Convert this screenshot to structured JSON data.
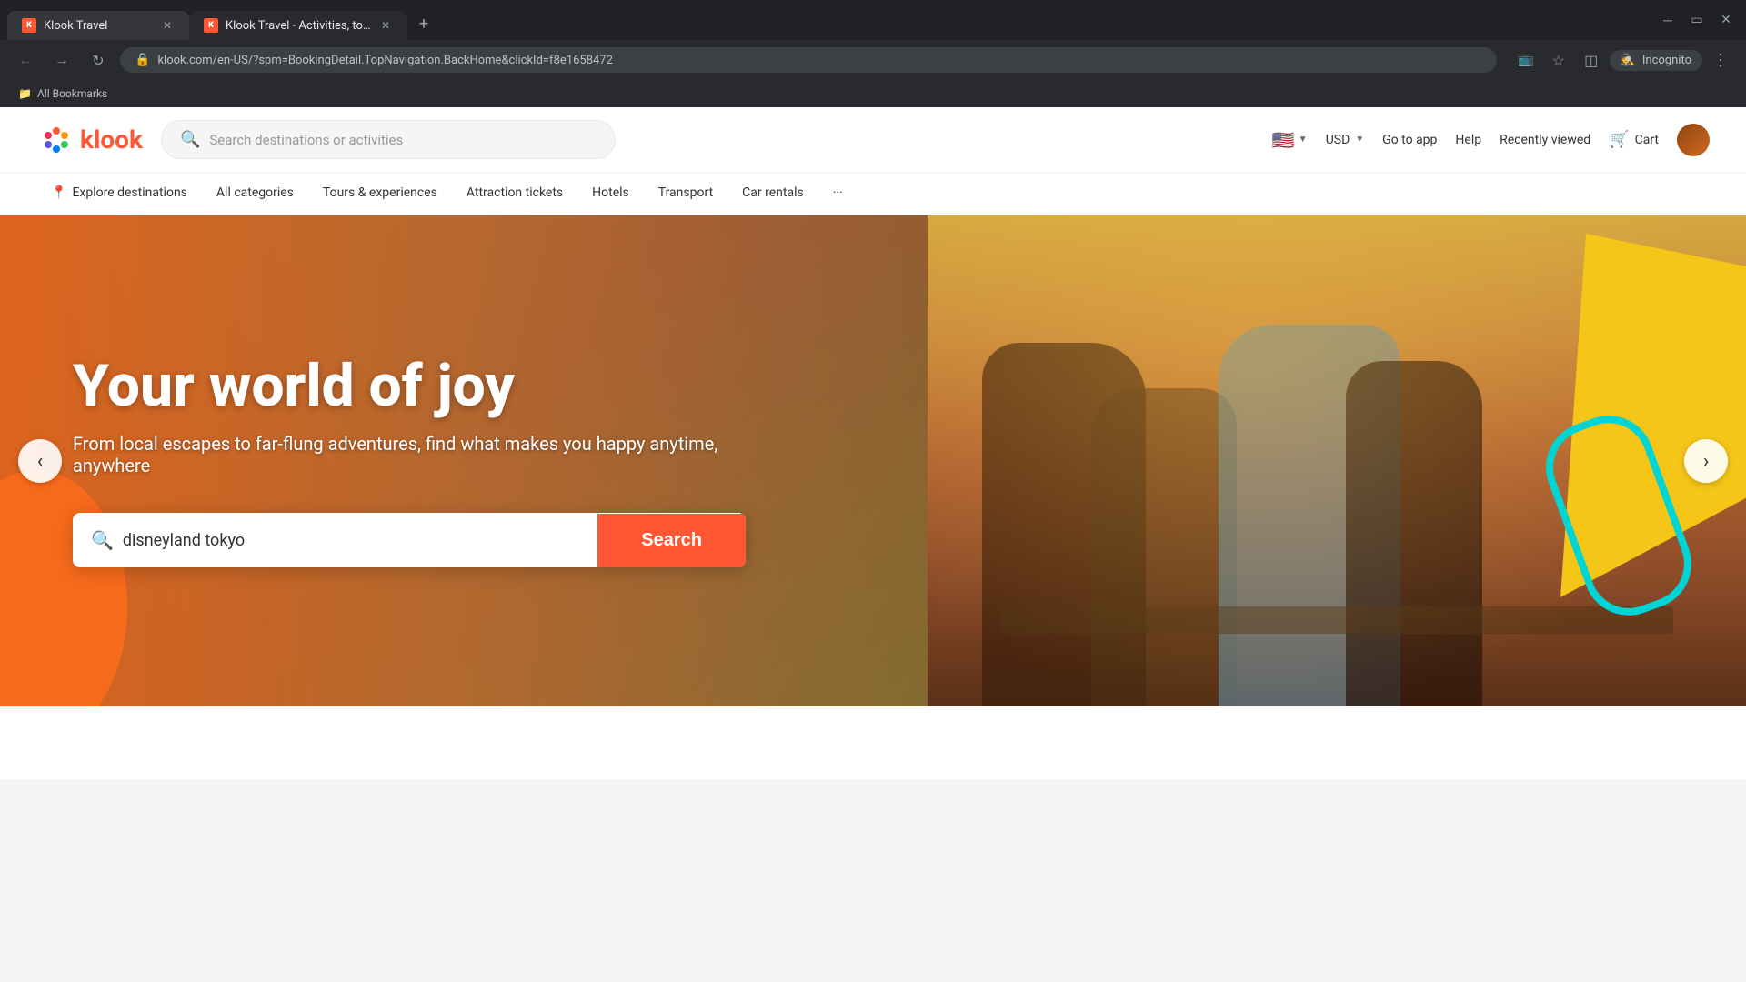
{
  "browser": {
    "tabs": [
      {
        "id": "tab1",
        "title": "Klook Travel",
        "url": "klook.com",
        "active": false,
        "favicon": "K"
      },
      {
        "id": "tab2",
        "title": "Klook Travel - Activities, tours,",
        "url": "klook.com/en-US/?spm=BookingDetail.TopNavigation.BackHome&clickId=f8e1658472",
        "active": true,
        "favicon": "K"
      }
    ],
    "new_tab_label": "+",
    "window_controls": [
      "–",
      "□",
      "✕"
    ],
    "address": "klook.com/en-US/?spm=BookingDetail.TopNavigation.BackHome&clickId=f8e1658472",
    "incognito_label": "Incognito",
    "bookmarks_label": "All Bookmarks"
  },
  "header": {
    "logo_text": "klook",
    "search_placeholder": "Search destinations or activities",
    "nav_links": [
      {
        "label": "Go to app"
      },
      {
        "label": "Help"
      },
      {
        "label": "Recently viewed"
      },
      {
        "label": "Cart"
      }
    ],
    "currency": "USD",
    "flag_alt": "US Flag"
  },
  "nav": {
    "items": [
      {
        "label": "Explore destinations",
        "icon": "📍",
        "active": false
      },
      {
        "label": "All categories",
        "active": false
      },
      {
        "label": "Tours & experiences",
        "active": false
      },
      {
        "label": "Attraction tickets",
        "active": false
      },
      {
        "label": "Hotels",
        "active": false
      },
      {
        "label": "Transport",
        "active": false
      },
      {
        "label": "Car rentals",
        "active": false
      },
      {
        "label": "···",
        "active": false
      }
    ]
  },
  "hero": {
    "title": "Your world of joy",
    "subtitle": "From local escapes to far-flung adventures, find what makes you happy anytime, anywhere",
    "search_value": "disneyland tokyo",
    "search_placeholder": "Search",
    "search_btn_label": "Search",
    "prev_arrow": "‹",
    "next_arrow": "›"
  }
}
